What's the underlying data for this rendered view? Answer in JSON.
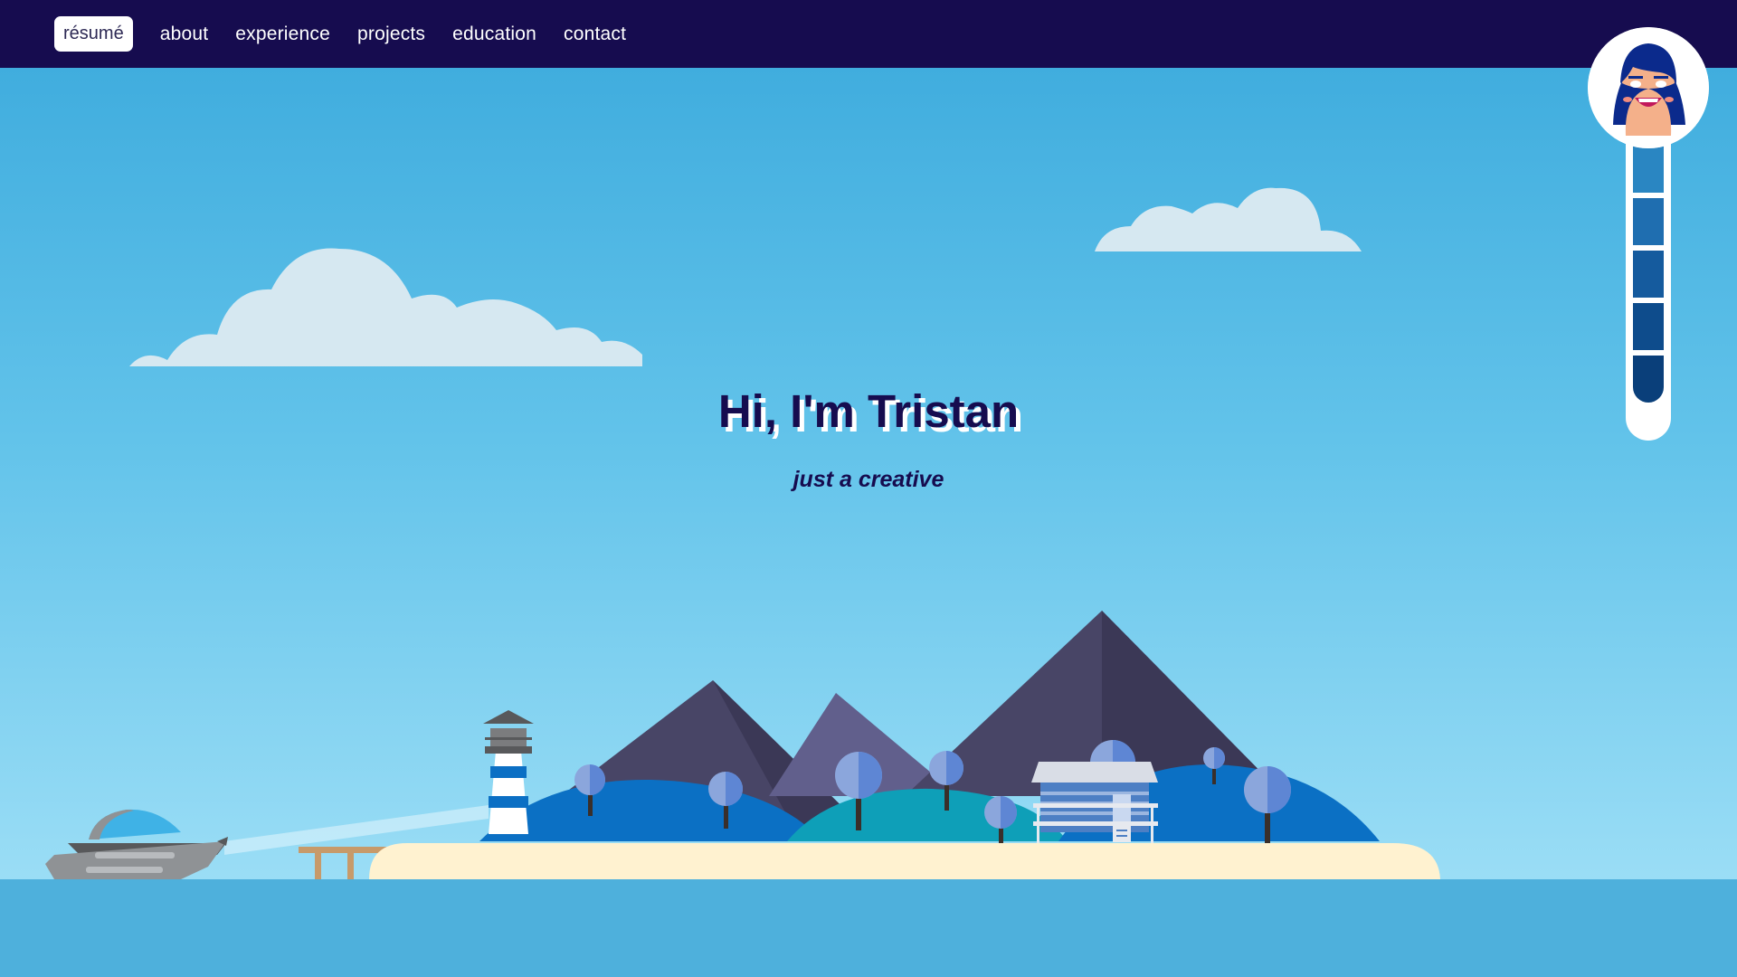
{
  "nav": {
    "resume_label": "résumé",
    "items": [
      {
        "label": "about"
      },
      {
        "label": "experience"
      },
      {
        "label": "projects"
      },
      {
        "label": "education"
      },
      {
        "label": "contact"
      }
    ]
  },
  "hero": {
    "title": "Hi, I'm Tristan",
    "subtitle": "just a creative"
  },
  "colors": {
    "nav_bg": "#160c4f",
    "title": "#160c4f",
    "sky_top": "#3aa9dc",
    "sky_bottom": "#a7e3f8",
    "sea": "#4eb0dc",
    "sand": "#fff2d0"
  },
  "icons": {
    "avatar": "avatar-icon",
    "lighthouse": "lighthouse-icon",
    "boat": "boat-icon",
    "house": "house-icon"
  },
  "scroll_progress": {
    "segments": 5,
    "filled": 5
  }
}
